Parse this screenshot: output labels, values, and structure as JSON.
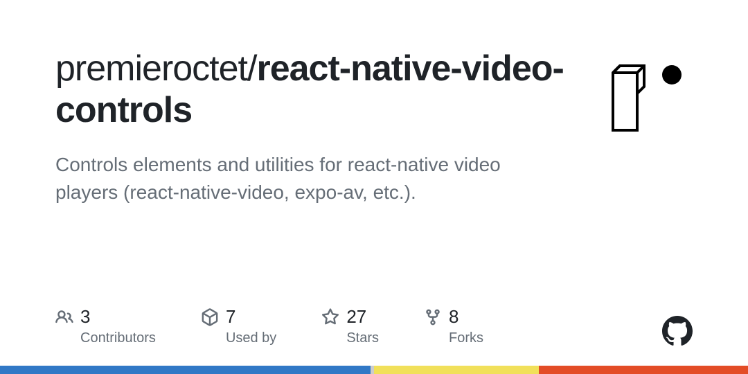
{
  "repo": {
    "owner": "premieroctet",
    "separator": "/",
    "name": "react-native-video-controls"
  },
  "description": "Controls elements and utilities for react-native video players (react-native-video, expo-av, etc.).",
  "stats": {
    "contributors": {
      "value": "3",
      "label": "Contributors"
    },
    "usedby": {
      "value": "7",
      "label": "Used by"
    },
    "stars": {
      "value": "27",
      "label": "Stars"
    },
    "forks": {
      "value": "8",
      "label": "Forks"
    }
  },
  "language_bar": [
    {
      "color": "#3178c6",
      "percent": 49.5
    },
    {
      "color": "#ccc",
      "percent": 0.5
    },
    {
      "color": "#f1e05a",
      "percent": 22
    },
    {
      "color": "#e34c26",
      "percent": 28
    }
  ]
}
